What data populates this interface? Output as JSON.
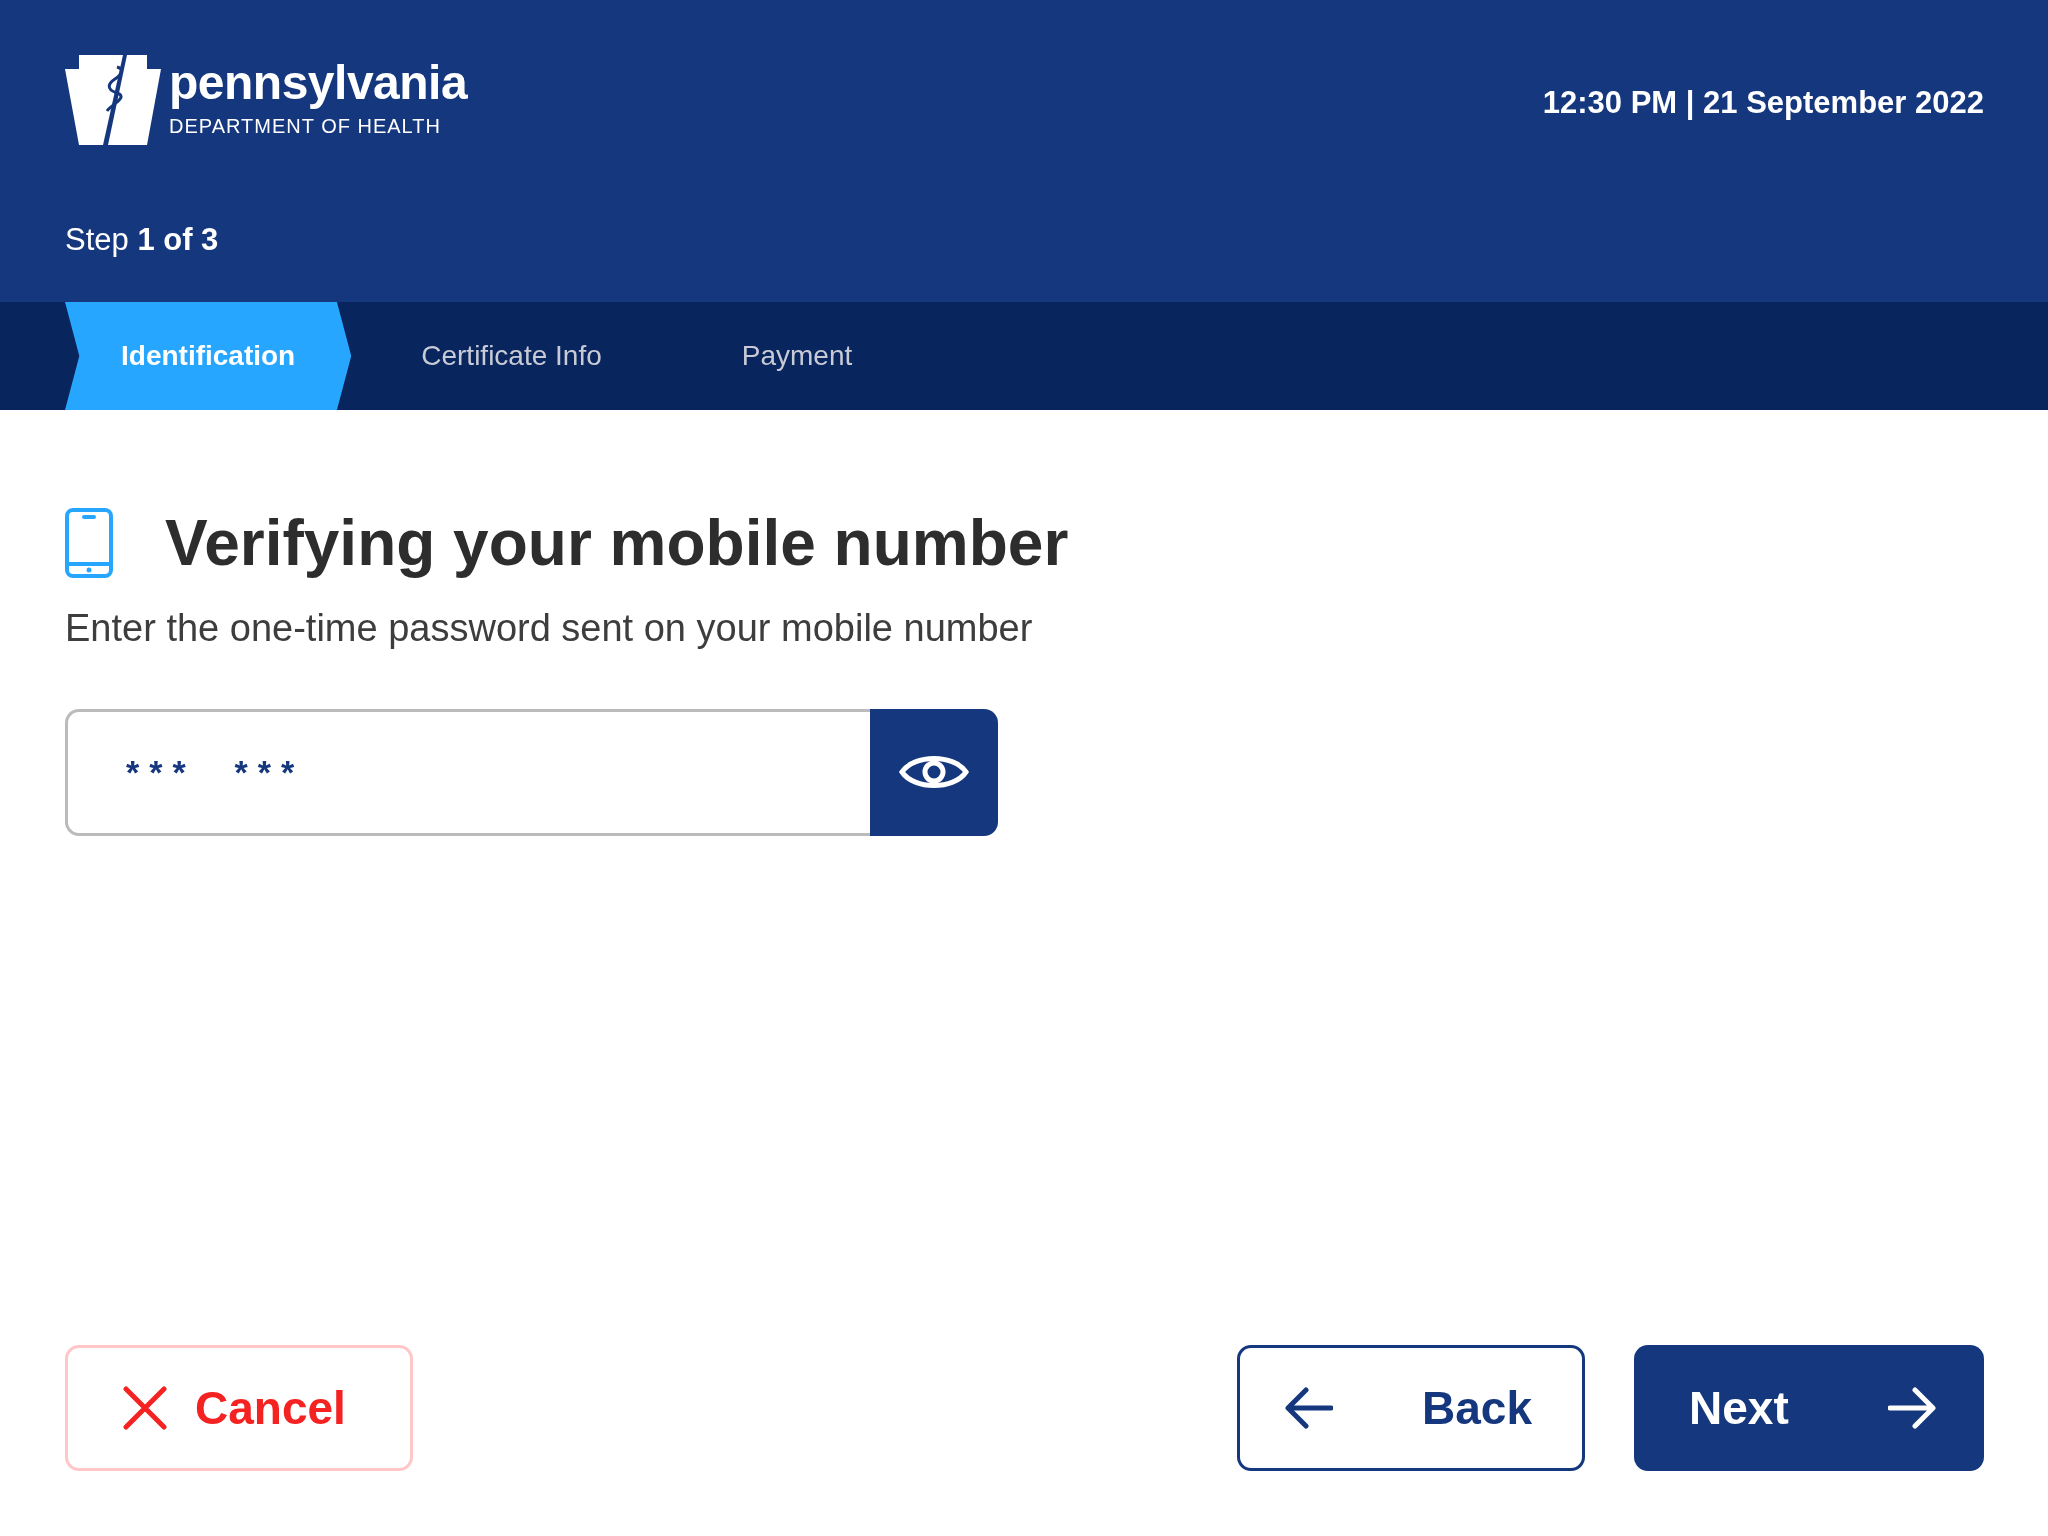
{
  "header": {
    "logo": {
      "name": "pennsylvania",
      "subtitle": "DEPARTMENT OF HEALTH"
    },
    "datetime": "12:30 PM | 21 September 2022",
    "step": "Step **1 of 3**"
  },
  "tabs": [
    {
      "label": "Identification",
      "selected": true
    },
    {
      "label": "Certificate Info",
      "selected": false
    },
    {
      "label": "Payment",
      "selected": false
    }
  ],
  "content": {
    "title": "Verifying your mobile number",
    "subtitle": "Enter the one-time password sent on your mobile number",
    "otp_field": {
      "value": "***  ***"
    }
  },
  "buttons": {
    "cancel": "Cancel",
    "back": "Back",
    "next": "Next"
  }
}
